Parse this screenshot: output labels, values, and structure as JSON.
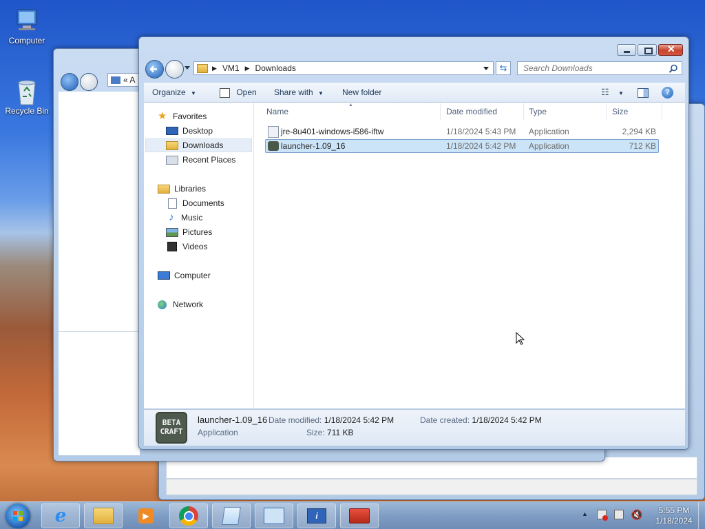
{
  "desktop": {
    "icons": [
      {
        "label": "Computer",
        "icon": "computer-icon"
      },
      {
        "label": "Recycle Bin",
        "icon": "recycle-bin-icon"
      }
    ]
  },
  "back_window": {
    "address_fragment": "«  A"
  },
  "explorer": {
    "breadcrumb": [
      "VM1",
      "Downloads"
    ],
    "search_placeholder": "Search Downloads",
    "toolbar": {
      "organize": "Organize",
      "open": "Open",
      "share_with": "Share with",
      "new_folder": "New folder"
    },
    "nav": {
      "favorites": "Favorites",
      "desktop": "Desktop",
      "downloads": "Downloads",
      "recent_places": "Recent Places",
      "libraries": "Libraries",
      "documents": "Documents",
      "music": "Music",
      "pictures": "Pictures",
      "videos": "Videos",
      "computer": "Computer",
      "network": "Network"
    },
    "columns": {
      "name": "Name",
      "date": "Date modified",
      "type": "Type",
      "size": "Size"
    },
    "files": [
      {
        "name": "jre-8u401-windows-i586-iftw",
        "date": "1/18/2024 5:43 PM",
        "type": "Application",
        "size": "2,294 KB"
      },
      {
        "name": "launcher-1.09_16",
        "date": "1/18/2024 5:42 PM",
        "type": "Application",
        "size": "712 KB"
      }
    ],
    "details": {
      "name": "launcher-1.09_16",
      "kind": "Application",
      "modified_label": "Date modified:",
      "modified_value": "1/18/2024 5:42 PM",
      "created_label": "Date created:",
      "created_value": "1/18/2024 5:42 PM",
      "size_label": "Size:",
      "size_value": "711 KB",
      "thumb_text_1": "BETA",
      "thumb_text_2": "CRAFT"
    }
  },
  "taskbar": {
    "time": "5:55 PM",
    "date": "1/18/2024",
    "apps": [
      "start-orb-icon",
      "internet-explorer-icon",
      "file-explorer-icon",
      "media-player-icon",
      "chrome-icon",
      "notepad-icon",
      "control-panel-icon",
      "system-info-icon",
      "toolbox-icon"
    ]
  },
  "colors": {
    "selection": "#cce4f7",
    "selection_border": "#7da2ce",
    "accent": "#1e5fb4"
  }
}
